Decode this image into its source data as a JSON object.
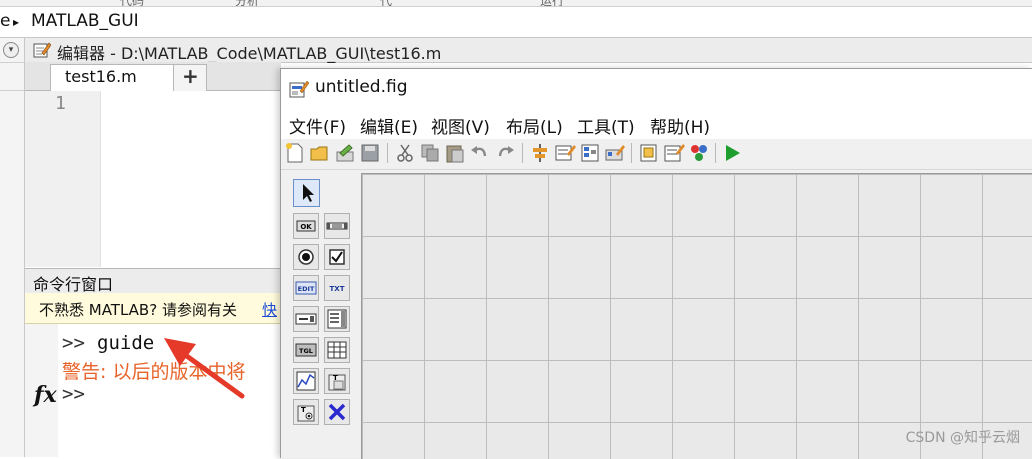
{
  "top_tabs": [
    "代码",
    "分析",
    "代",
    "运行"
  ],
  "address_bar": {
    "prefix": "e",
    "separator": "▸",
    "folder": "MATLAB_GUI"
  },
  "editor": {
    "title": "编辑器 - D:\\MATLAB_Code\\MATLAB_GUI\\test16.m",
    "tab_label": "test16.m",
    "tab_close": "✕",
    "add_tab": "+",
    "line_number": "1"
  },
  "command_window": {
    "title": "命令行窗口",
    "notice_text": "不熟悉 MATLAB? 请参阅有关",
    "notice_link": "快",
    "prompt": ">>",
    "command": "guide",
    "warning": "警告: 以后的版本中将",
    "fx_label": "fx",
    "next_prompt": ">>"
  },
  "guide": {
    "window_title": "untitled.fig",
    "menus": [
      "文件(F)",
      "编辑(E)",
      "视图(V)",
      "布局(L)",
      "工具(T)",
      "帮助(H)"
    ],
    "palette_labels": {
      "pushbutton": "OK",
      "edit": "EDIT",
      "text": "TXT",
      "toggle": "TGL"
    }
  },
  "watermark": "CSDN @知乎云烟",
  "colors": {
    "warning": "#e8632a",
    "arrow": "#e53a2a",
    "link": "#1a4bd6",
    "run": "#1e9e2e",
    "notice_bg": "#fffbdc"
  }
}
